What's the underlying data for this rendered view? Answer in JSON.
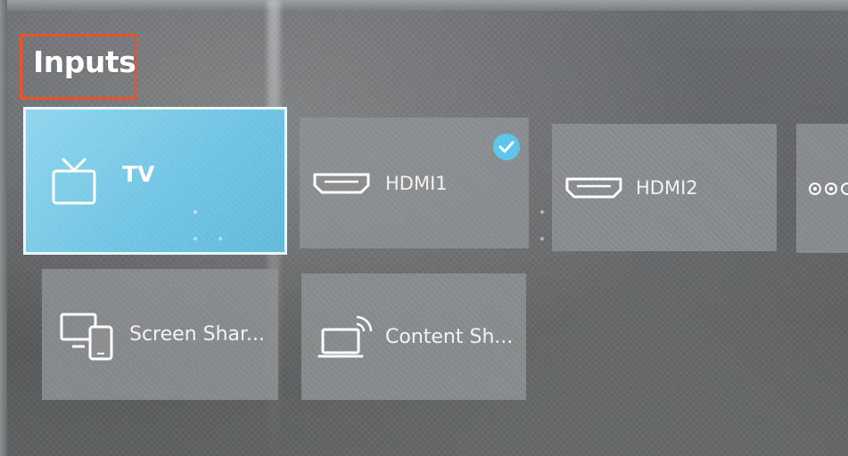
{
  "header": {
    "title": "Inputs"
  },
  "inputs": [
    {
      "label": "TV",
      "icon": "tv-icon",
      "selected": true
    },
    {
      "label": "HDMI1",
      "icon": "hdmi-icon",
      "checked": true
    },
    {
      "label": "HDMI2",
      "icon": "hdmi-icon"
    },
    {
      "label": "",
      "icon": "av-icon"
    },
    {
      "label": "Screen Shar...",
      "icon": "screen-share-icon"
    },
    {
      "label": "Content Sh...",
      "icon": "content-share-icon"
    }
  ],
  "colors": {
    "highlight": "#e8532a",
    "selected_tile": "#6ec3e2",
    "check_badge": "#5ec6ea"
  }
}
